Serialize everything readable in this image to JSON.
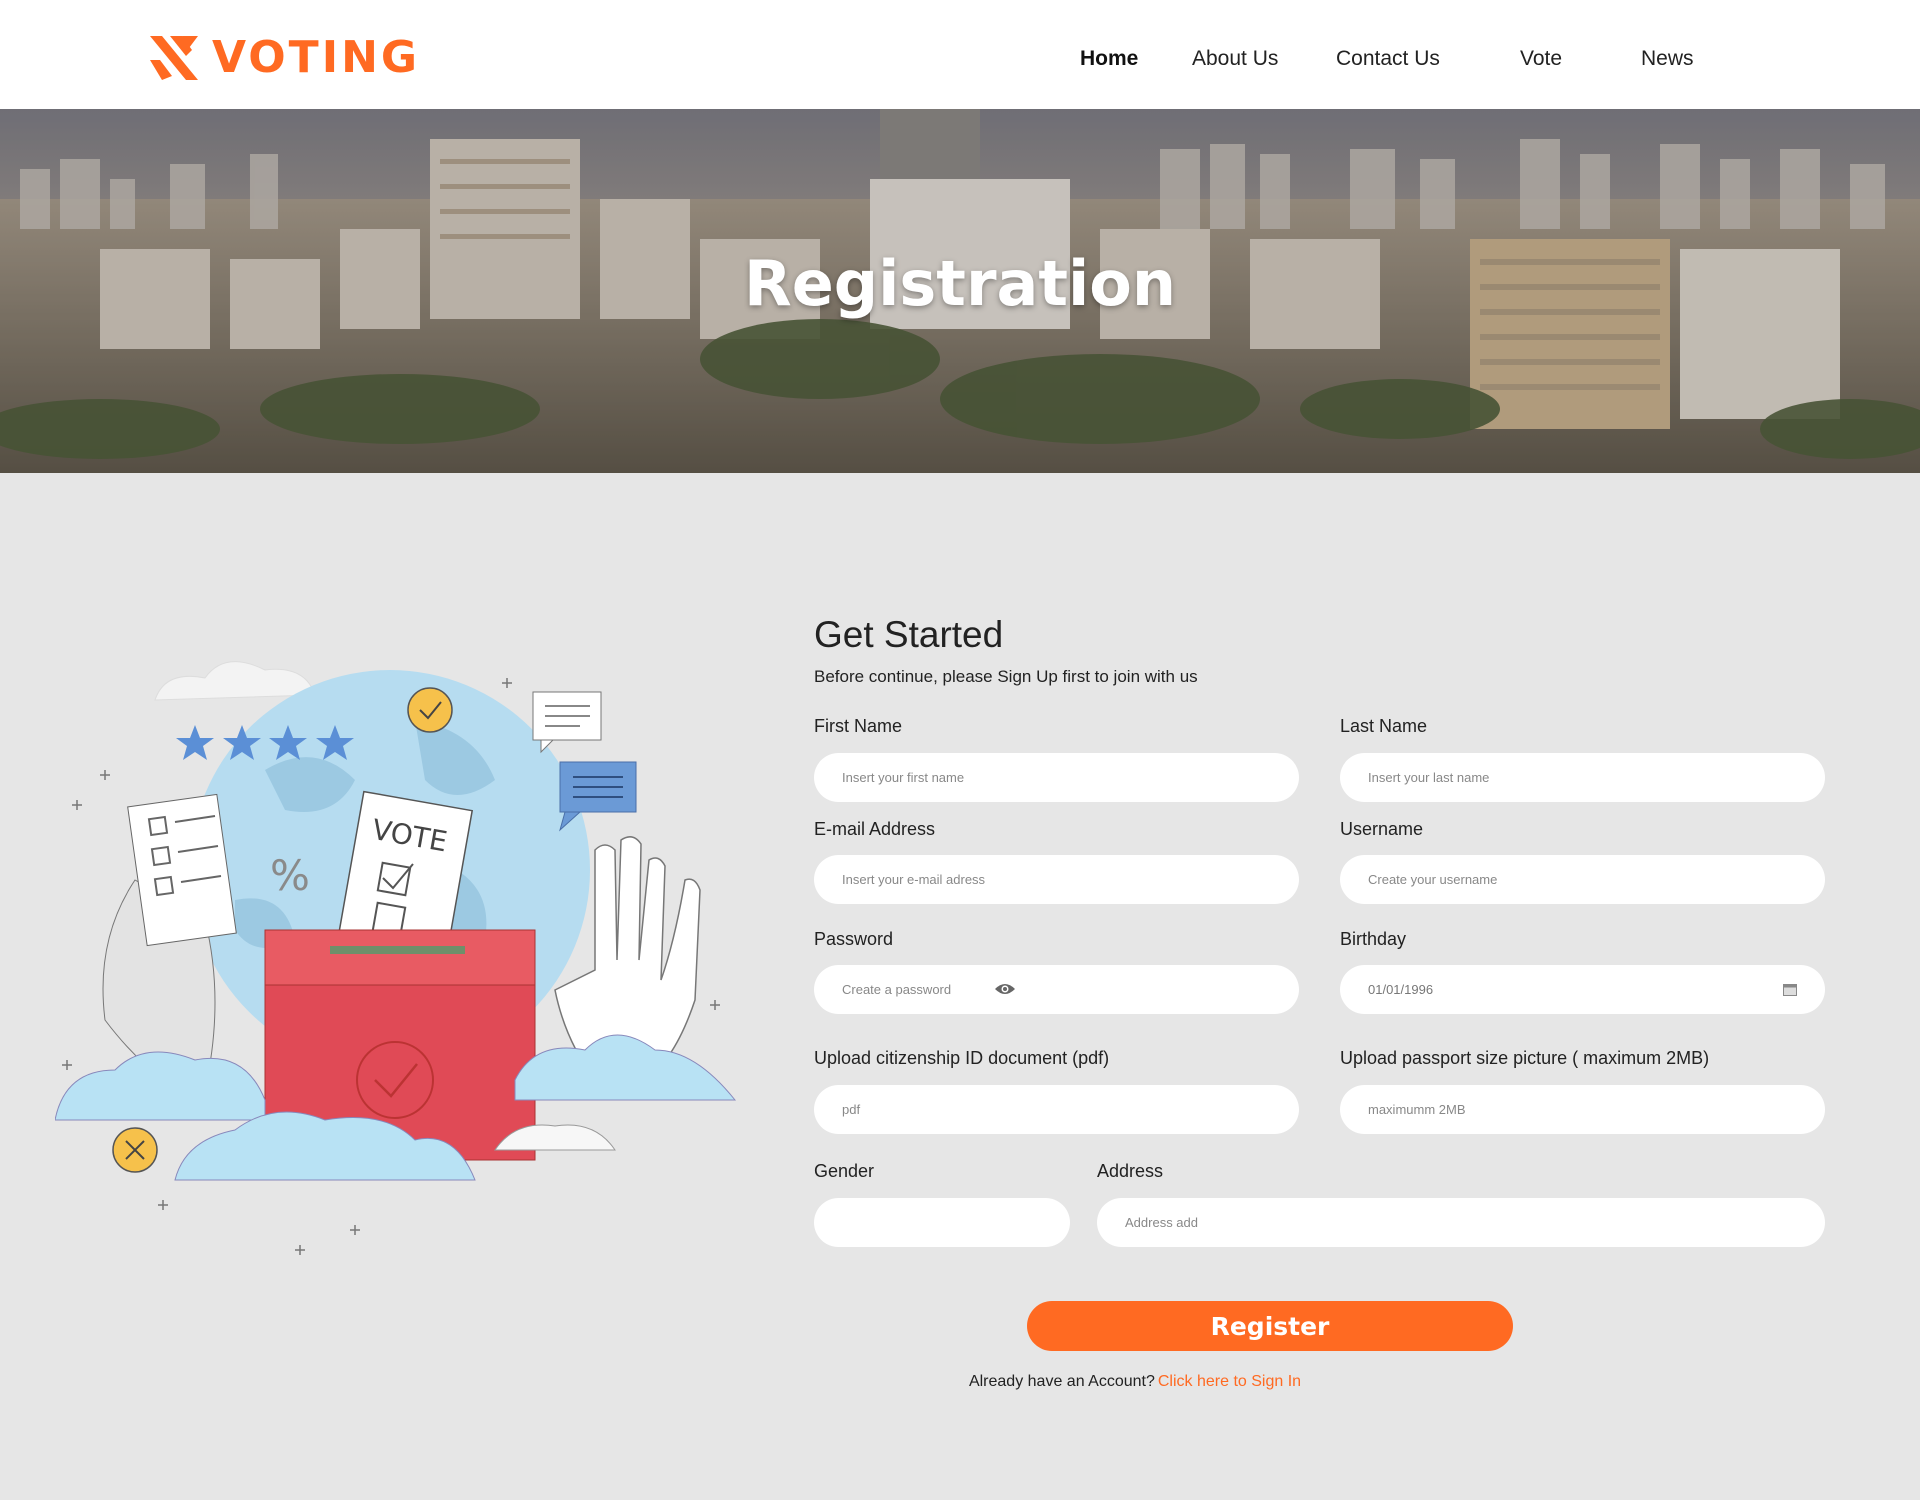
{
  "brand": {
    "name": "VOTING",
    "accent": "#ff6a22"
  },
  "nav": {
    "items": [
      {
        "label": "Home",
        "active": true
      },
      {
        "label": "About Us",
        "active": false
      },
      {
        "label": "Contact Us",
        "active": false
      },
      {
        "label": "Vote",
        "active": false
      },
      {
        "label": "News",
        "active": false
      }
    ]
  },
  "hero": {
    "title": "Registration"
  },
  "illustration": {
    "ballot_text": "VOTE",
    "percent_text": "%"
  },
  "form": {
    "title": "Get Started",
    "subtitle": "Before continue, please Sign Up first to join with us",
    "first_name": {
      "label": "First Name",
      "placeholder": "Insert your first name"
    },
    "last_name": {
      "label": "Last Name",
      "placeholder": "Insert your last name"
    },
    "email": {
      "label": "E-mail Address",
      "placeholder": "Insert your e-mail adress"
    },
    "username": {
      "label": "Username",
      "placeholder": "Create your username"
    },
    "password": {
      "label": "Password",
      "placeholder": "Create a password",
      "icon": "eye-icon"
    },
    "birthday": {
      "label": "Birthday",
      "value": "01/01/1996",
      "icon": "calendar-icon"
    },
    "citizenship_doc": {
      "label": "Upload citizenship ID document (pdf)",
      "placeholder": "pdf"
    },
    "passport_pic": {
      "label": "Upload passport size picture ( maximum 2MB)",
      "placeholder": "maximumm 2MB"
    },
    "gender": {
      "label": "Gender",
      "value": ""
    },
    "address": {
      "label": "Address",
      "placeholder": "Address add"
    },
    "register_label": "Register",
    "signin_prompt": "Already have an Account?",
    "signin_link": "Click here to Sign In"
  }
}
